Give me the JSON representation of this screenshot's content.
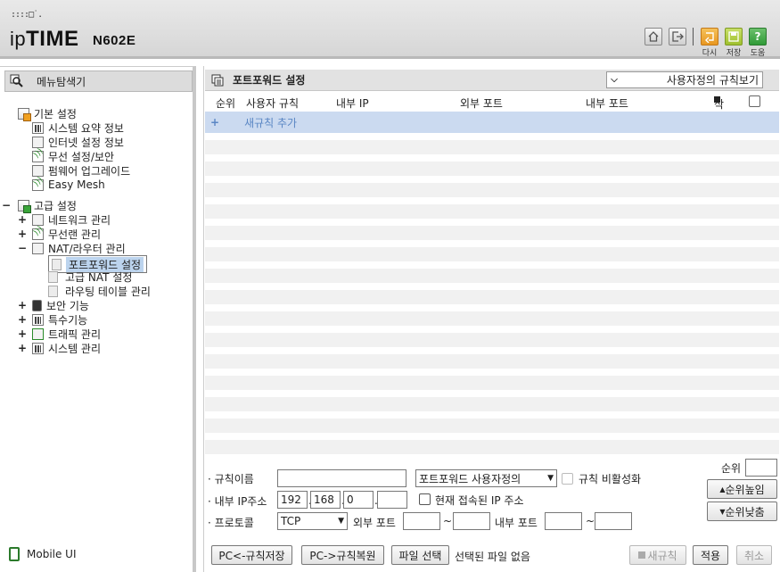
{
  "header": {
    "logo_dots": "::::□˙.",
    "logo_ip": "ip",
    "logo_time": "TIME",
    "model": "N602E",
    "buttons": [
      {
        "name": "home",
        "label": ""
      },
      {
        "name": "logout",
        "label": ""
      },
      {
        "name": "reload",
        "label": "다시"
      },
      {
        "name": "save",
        "label": "저장"
      },
      {
        "name": "help",
        "label": "도움"
      }
    ],
    "help_glyph": "?"
  },
  "left": {
    "title": "메뉴탐색기",
    "tree": [
      {
        "label": "기본 설정",
        "expander": "",
        "icon": "folder",
        "level": 0
      },
      {
        "label": "시스템 요약 정보",
        "expander": "",
        "icon": "bars",
        "level": 1
      },
      {
        "label": "인터넷 설정 정보",
        "expander": "",
        "icon": "monitor",
        "level": 1
      },
      {
        "label": "무선 설정/보안",
        "expander": "",
        "icon": "wifi",
        "level": 1
      },
      {
        "label": "펌웨어 업그레이드",
        "expander": "",
        "icon": "upload",
        "level": 1
      },
      {
        "label": "Easy Mesh",
        "expander": "",
        "icon": "wifi",
        "level": 1
      },
      {
        "label": "고급 설정",
        "expander": "−",
        "icon": "folder-green",
        "level": 0
      },
      {
        "label": "네트워크 관리",
        "expander": "+",
        "icon": "network",
        "level": 1
      },
      {
        "label": "무선랜 관리",
        "expander": "+",
        "icon": "wifi",
        "level": 1
      },
      {
        "label": "NAT/라우터 관리",
        "expander": "−",
        "icon": "router",
        "level": 1
      },
      {
        "label": "포트포워드 설정",
        "expander": "",
        "icon": "page",
        "level": 2,
        "selected": true
      },
      {
        "label": "고급 NAT 설정",
        "expander": "",
        "icon": "page",
        "level": 2
      },
      {
        "label": "라우팅 테이블 관리",
        "expander": "",
        "icon": "page",
        "level": 2
      },
      {
        "label": "보안 기능",
        "expander": "+",
        "icon": "lock",
        "level": 1
      },
      {
        "label": "특수기능",
        "expander": "+",
        "icon": "special",
        "level": 1
      },
      {
        "label": "트래픽 관리",
        "expander": "+",
        "icon": "traffic",
        "level": 1
      },
      {
        "label": "시스템 관리",
        "expander": "+",
        "icon": "bars",
        "level": 1
      }
    ],
    "mobile_ui": "Mobile UI"
  },
  "right": {
    "title": "포트포워드 설정",
    "view_select": "사용자정의 규칙보기",
    "columns": {
      "order": "순위",
      "user_rule": "사용자 규칙",
      "internal_ip": "내부 IP",
      "external_port": "외부 포트",
      "internal_port": "내부 포트",
      "delete": "삭제"
    },
    "add_row": {
      "plus": "+",
      "label": "새규칙 추가"
    },
    "form": {
      "rule_name_label": "규칙이름",
      "rule_name_value": "",
      "rule_type_select": "포트포워드 사용자정의",
      "disable_rule_label": "규칙 비활성화",
      "internal_ip_label": "내부 IP주소",
      "ip": [
        "192",
        "168",
        "0",
        ""
      ],
      "current_ip_label": "현재 접속된 IP 주소",
      "protocol_label": "프로토콜",
      "protocol_value": "TCP",
      "ext_port_label": "외부 포트",
      "int_port_label": "내부 포트",
      "tilde": "~",
      "order_label": "순위",
      "order_value": "",
      "order_up": "순위높임",
      "order_down": "순위낮춤"
    },
    "bottom": {
      "save_to_pc": "PC<-규칙저장",
      "restore_from_pc": "PC->규칙복원",
      "file_select": "파일 선택",
      "file_status": "선택된 파일 없음",
      "new_rule": "새규칙",
      "apply": "적용",
      "cancel": "취소"
    }
  }
}
